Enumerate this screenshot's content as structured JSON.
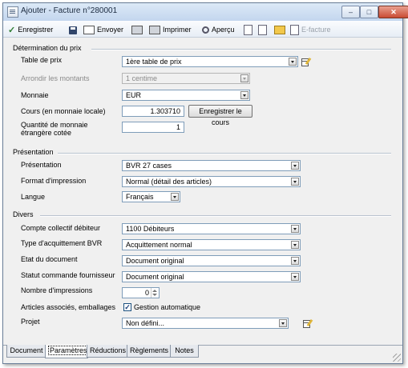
{
  "window": {
    "title": "Ajouter - Facture n°280001"
  },
  "toolbar": {
    "save": "Enregistrer",
    "send": "Envoyer",
    "print": "Imprimer",
    "preview": "Aperçu",
    "efacture": "E-facture"
  },
  "groups": {
    "pricing": "Détermination du prix",
    "presentation": "Présentation",
    "misc": "Divers"
  },
  "fields": {
    "price_table": {
      "label": "Table de prix",
      "value": "1ère table de prix"
    },
    "rounding": {
      "label": "Arrondir les montants",
      "value": "1 centime"
    },
    "currency": {
      "label": "Monnaie",
      "value": "EUR"
    },
    "rate": {
      "label": "Cours (en monnaie locale)",
      "value": "1.303710",
      "button": "Enregistrer le cours"
    },
    "qty_foreign": {
      "label_line1": "Quantité de monnaie",
      "label_line2": "étrangère cotée",
      "value": "1"
    },
    "presentation": {
      "label": "Présentation",
      "value": "BVR 27 cases"
    },
    "print_format": {
      "label": "Format d'impression",
      "value": "Normal (détail des articles)"
    },
    "language": {
      "label": "Langue",
      "value": "Français"
    },
    "account": {
      "label": "Compte collectif débiteur",
      "value": "1100 Débiteurs"
    },
    "bvr_type": {
      "label": "Type d'acquittement BVR",
      "value": "Acquittement normal"
    },
    "doc_state": {
      "label": "Etat du document",
      "value": "Document original"
    },
    "supplier_status": {
      "label": "Statut commande fournisseur",
      "value": "Document original"
    },
    "prints": {
      "label": "Nombre d'impressions",
      "value": "0"
    },
    "linked": {
      "label": "Articles associés, emballages",
      "checkbox_label": "Gestion automatique",
      "checked": true
    },
    "project": {
      "label": "Projet",
      "value": "Non défini..."
    }
  },
  "tabs": [
    "Document",
    "Paramètres",
    "Réductions",
    "Règlements",
    "Notes"
  ],
  "active_tab": "Paramètres"
}
